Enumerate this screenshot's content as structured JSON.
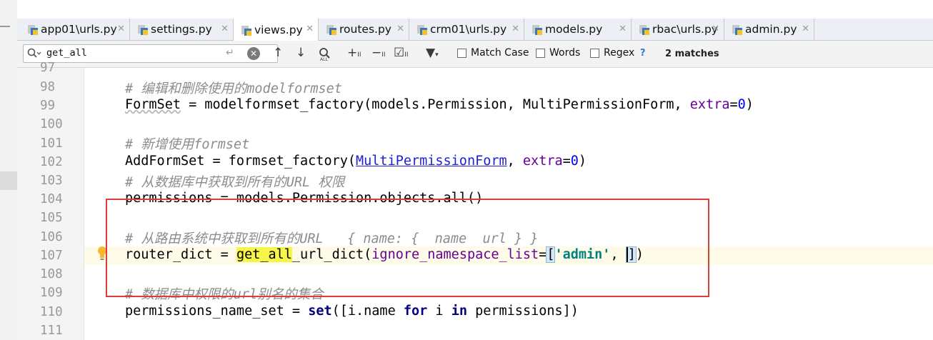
{
  "tabs": [
    {
      "label": "app01\\urls.py",
      "icon": "python-file-icon",
      "active": false
    },
    {
      "label": "settings.py",
      "icon": "python-file-icon",
      "active": false
    },
    {
      "label": "views.py",
      "icon": "python-file-icon",
      "active": true
    },
    {
      "label": "routes.py",
      "icon": "python-file-icon",
      "active": false
    },
    {
      "label": "crm01\\urls.py",
      "icon": "python-file-icon",
      "active": false
    },
    {
      "label": "models.py",
      "icon": "python-file-icon",
      "active": false
    },
    {
      "label": "rbac\\urls.py",
      "icon": "python-file-icon",
      "active": false
    },
    {
      "label": "admin.py",
      "icon": "python-file-icon",
      "active": false
    }
  ],
  "search": {
    "query": "get_all",
    "match_case_label": "Match Case",
    "words_label": "Words",
    "regex_label": "Regex",
    "help_label": "?",
    "match_count": "2 matches"
  },
  "editor": {
    "line_numbers": [
      "97",
      "98",
      "99",
      "100",
      "101",
      "102",
      "103",
      "104",
      "105",
      "106",
      "107",
      "108",
      "109",
      "110",
      "111"
    ],
    "lines": {
      "l98": "# 编辑和删除使用的modelformset",
      "l99_a": "FormSet",
      "l99_b": " = modelformset_factory(models.Permission, MultiPermissionForm, ",
      "l99_kw": "extra",
      "l99_eq": "=",
      "l99_num": "0",
      "l99_end": ")",
      "l101": "# 新增使用formset",
      "l102_a": "AddFormSet = formset_factory(",
      "l102_link": "MultiPermissionForm",
      "l102_b": ", ",
      "l102_kw": "extra",
      "l102_eq": "=",
      "l102_num": "0",
      "l102_end": ")",
      "l103": "# 从数据库中获取到所有的URL 权限",
      "l104": "permissions = models.Permission.objects.all()",
      "l106": "# 从路由系统中获取到所有的URL   { name: {  name  url } }",
      "l107_a": "router_dict = ",
      "l107_hl": "get_all",
      "l107_b": "_url_dict(",
      "l107_kw": "ignore_namespace_list",
      "l107_eq": "=",
      "l107_open": "[",
      "l107_str": "'admin'",
      "l107_c": ", ",
      "l107_close": "]",
      "l107_end": ")",
      "l109": "# 数据库中权限的url别名的集合",
      "l110_a": "permissions_name_set = ",
      "l110_set": "set",
      "l110_b": "([i.name ",
      "l110_for": "for",
      "l110_c": " i ",
      "l110_in": "in",
      "l110_d": " permissions])"
    }
  },
  "colors": {
    "highlight_box": "#e03a3a",
    "search_match": "#f5f54a",
    "comment": "#8c8c8c",
    "keyword": "#000080",
    "string": "#008080",
    "kwarg": "#660099"
  }
}
